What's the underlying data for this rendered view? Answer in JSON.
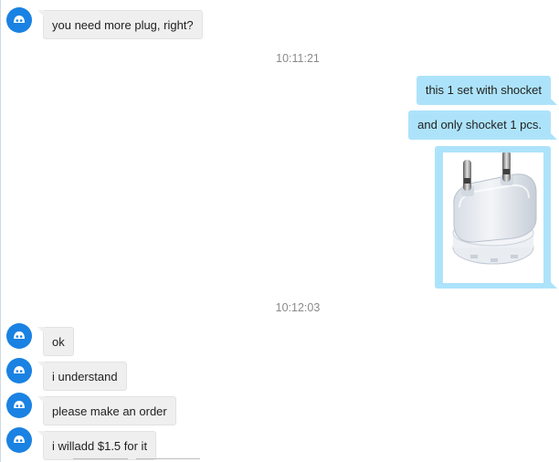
{
  "messages": {
    "m1": "you need more plug, right?",
    "m2": "this 1 set with shocket",
    "m3": "and only shocket 1 pcs.",
    "m4": "ok",
    "m5": "i understand",
    "m6": "please make an order",
    "m7": "i willadd $1.5 for it"
  },
  "timestamps": {
    "t1": "10:11:21",
    "t2": "10:12:03"
  },
  "colors": {
    "outgoing_bubble": "#ade3fa",
    "incoming_bubble": "#efefef",
    "avatar": "#1a82e2"
  },
  "icons": {
    "avatar": "bot-face-icon"
  }
}
